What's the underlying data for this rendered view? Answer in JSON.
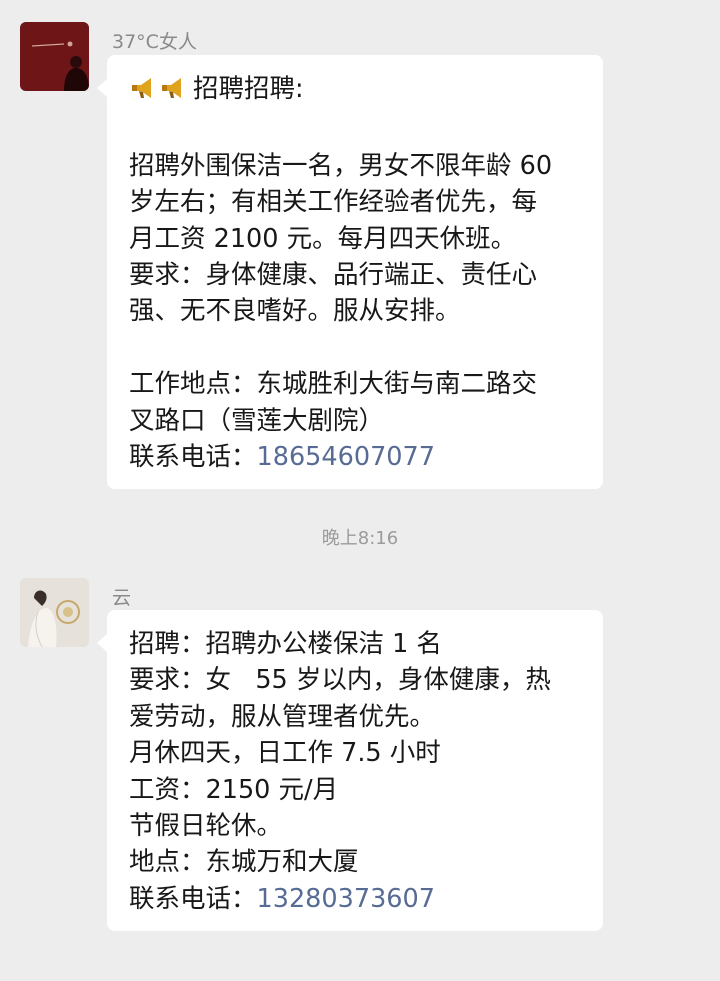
{
  "messages": [
    {
      "sender": "37°C女人",
      "avatar_icon": "dark-red-portrait-avatar",
      "lines": [
        "招聘招聘:",
        "",
        "招聘外围保洁一名，男女不限年龄 60",
        "岁左右；有相关工作经验者优先，每",
        "月工资 2100 元。每月四天休班。",
        "要求：身体健康、品行端正、责任心",
        "强、无不良嗜好。服从安排。",
        "",
        "工作地点：东城胜利大街与南二路交",
        "叉路口（雪莲大剧院）"
      ],
      "phone_label": "联系电话：",
      "phone": "18654607077"
    },
    {
      "sender": "云",
      "avatar_icon": "white-dress-figure-avatar",
      "lines": [
        "招聘：招聘办公楼保洁 1 名",
        "要求：女   55 岁以内，身体健康，热",
        "爱劳动，服从管理者优先。",
        "月休四天，日工作 7.5 小时",
        "工资：2150 元/月",
        "节假日轮休。",
        "地点：东城万和大厦"
      ],
      "phone_label": "联系电话：",
      "phone": "13280373607"
    }
  ],
  "timestamp": "晚上8:16",
  "colors": {
    "background": "#ededed",
    "bubble": "#ffffff",
    "link": "#576b95",
    "meta_text": "#8a8a8a"
  }
}
